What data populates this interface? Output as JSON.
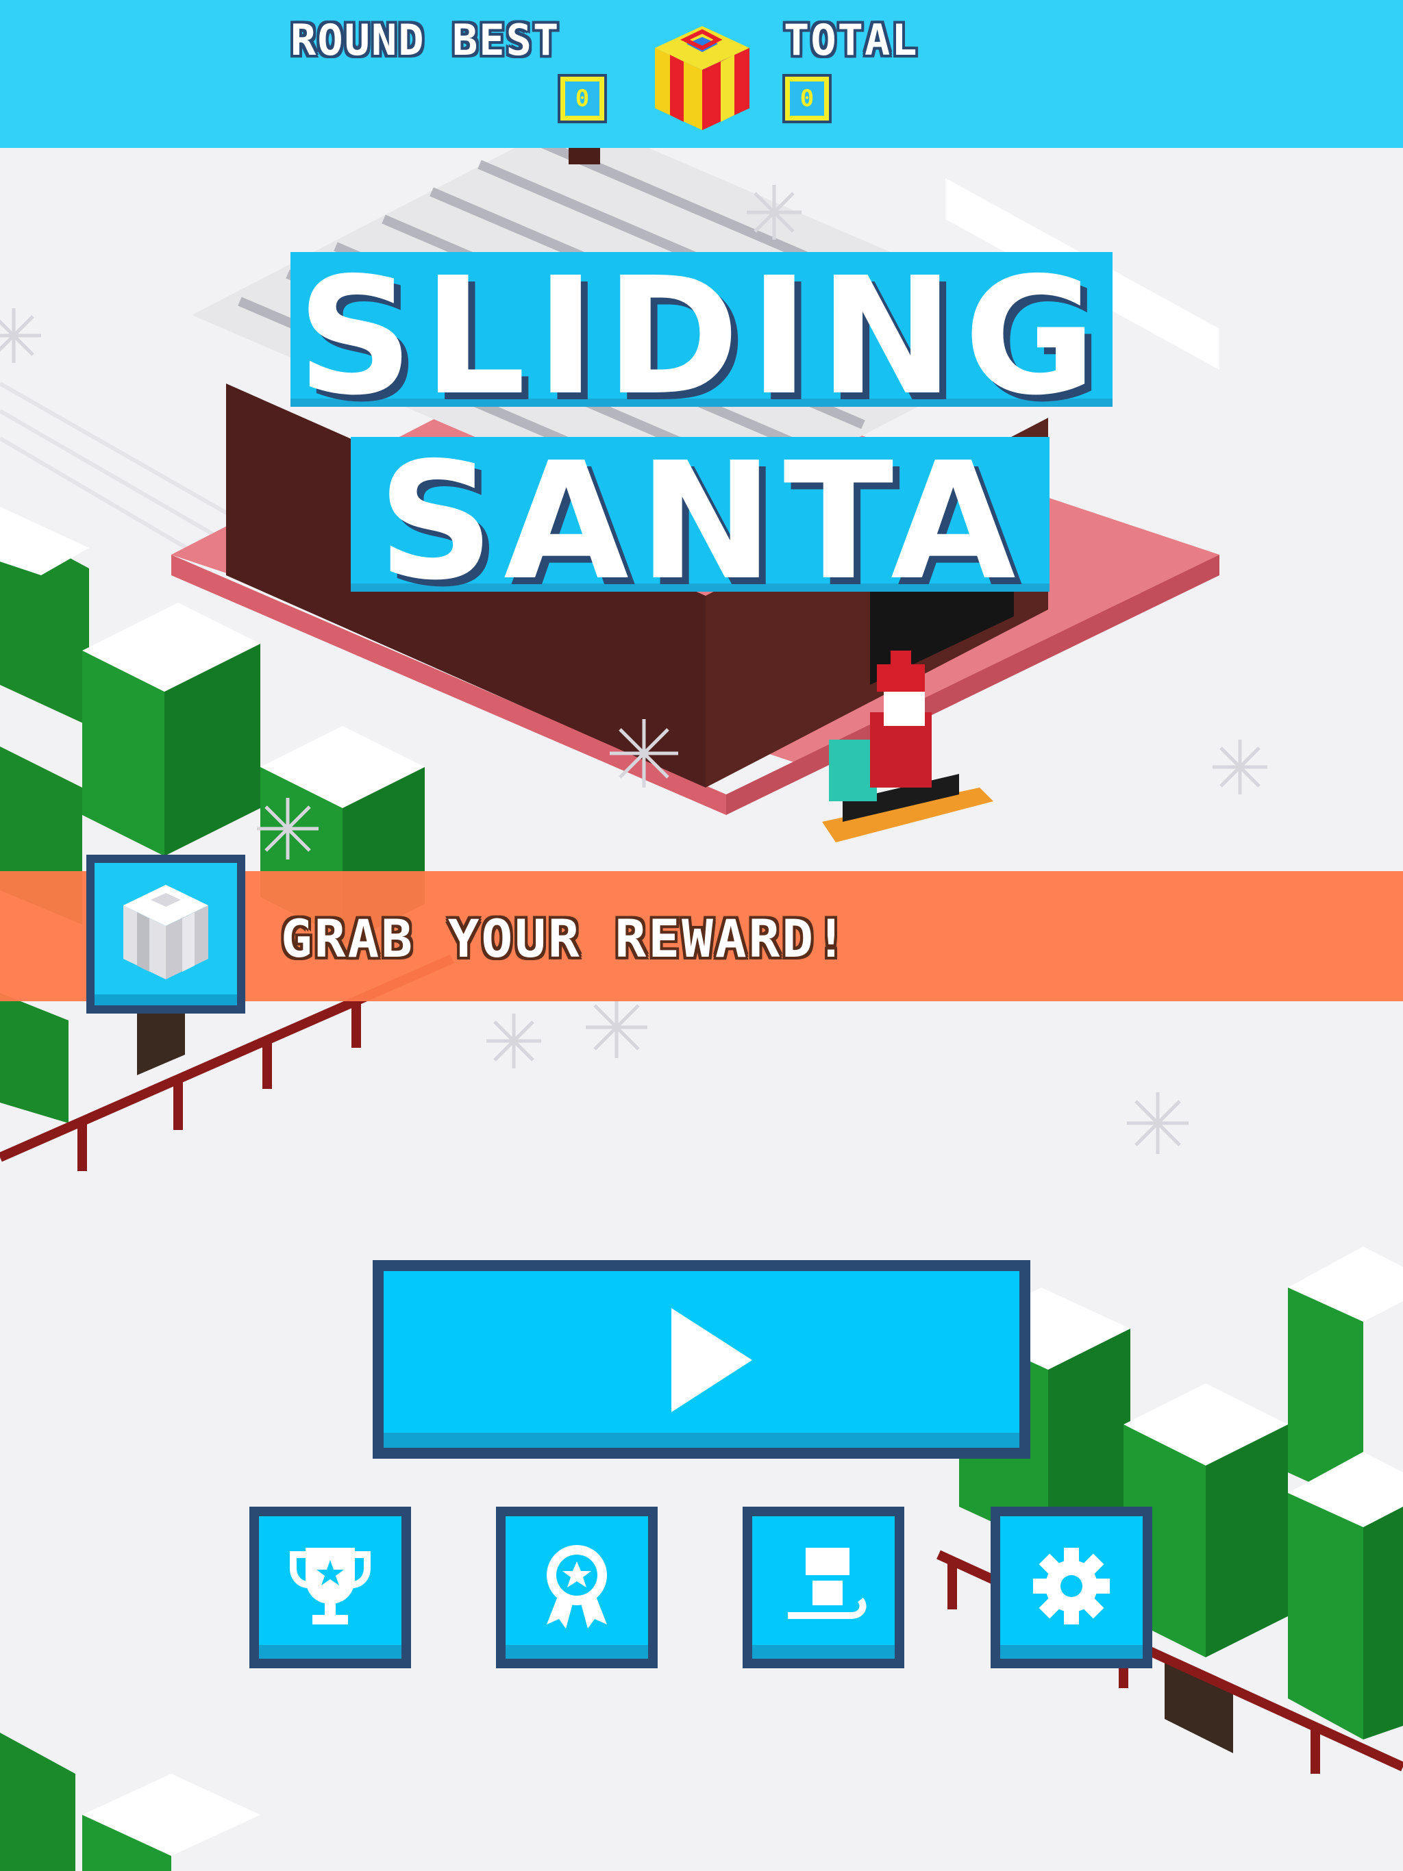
{
  "hud": {
    "round_best_label": "ROUND BEST",
    "round_best_value": "0",
    "total_label": "TOTAL",
    "total_value": "0",
    "gift_icon": "gift-box-icon"
  },
  "title": {
    "line1": "SLIDING",
    "line2": "SANTA"
  },
  "reward": {
    "label": "GRAB YOUR REWARD!",
    "icon": "gift-box-icon"
  },
  "buttons": {
    "play_icon": "play-icon",
    "leaderboard_icon": "trophy-icon",
    "achievements_icon": "award-ribbon-icon",
    "sled_shop_icon": "sled-icon",
    "settings_icon": "gear-icon"
  },
  "colors": {
    "sky_bar": "#33d0f7",
    "button_blue": "#02c8fb",
    "button_border": "#2a4a73",
    "reward_banner": "#ff7a4a",
    "snow": "#f2f2f4",
    "tree_green": "#1e8a2e",
    "house_brown": "#4e1f1c"
  }
}
